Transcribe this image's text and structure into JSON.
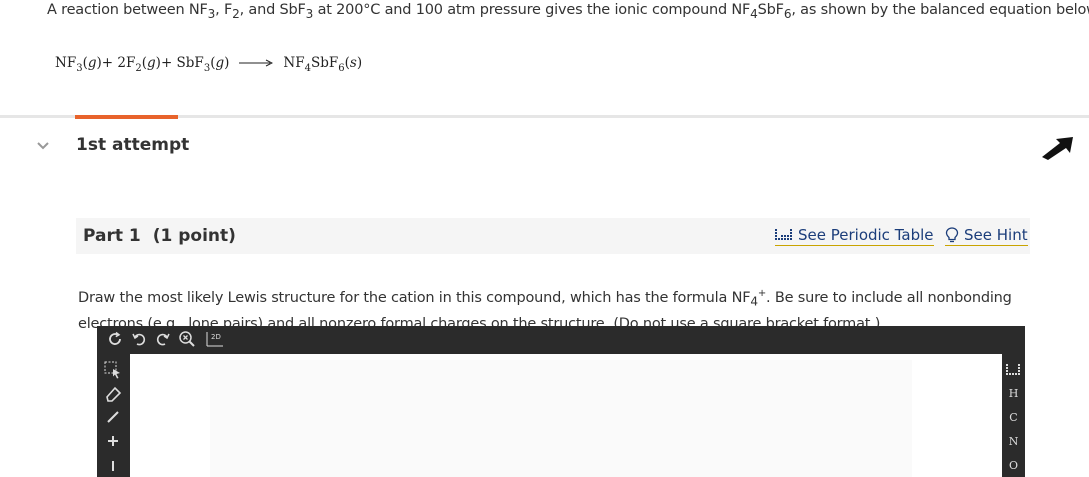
{
  "intro": {
    "p1": "A reaction between NF",
    "s1": "3",
    "p2": ", F",
    "s2": "2",
    "p3": ", and SbF",
    "s3": "3",
    "p4": " at 200°C and 100 atm pressure gives the ionic compound NF",
    "s4": "4",
    "p5": "SbF",
    "s5": "6",
    "p6": ", as shown by the balanced equation below."
  },
  "equation": {
    "t1": "NF",
    "t1s": "3",
    "t1st": "g",
    "plus1": " + 2F",
    "t2s": "2",
    "t2st": "g",
    "plus2": " + SbF",
    "t3s": "3",
    "t3st": "g",
    "p_a": "NF",
    "p_as": "4",
    "p_b": "SbF",
    "p_bs": "6",
    "p_st": "s"
  },
  "attempt": {
    "label": "1st attempt"
  },
  "part": {
    "label": "Part 1",
    "points": "(1 point)",
    "periodic_link": "See Periodic Table",
    "hint_link": "See Hint"
  },
  "question": {
    "q1": "Draw the most likely Lewis structure for the cation in this compound, which has the formula NF",
    "q1s": "4",
    "q1p": "+",
    "q2": ". Be sure to include all nonbonding electrons (e.g., lone pairs) and all nonzero formal charges on the structure. (Do not use a square bracket format.)"
  },
  "editor": {
    "mode_label": "2D",
    "left_tools": [
      "select-icon",
      "eraser-icon",
      "bond-icon",
      "charge-plus-icon",
      "charge-minus-icon"
    ],
    "elements": [
      "H",
      "C",
      "N",
      "O"
    ],
    "colors": {
      "accent": "#e8632b",
      "toolbar": "#2b2b2b",
      "link": "#1b3d7a"
    }
  }
}
